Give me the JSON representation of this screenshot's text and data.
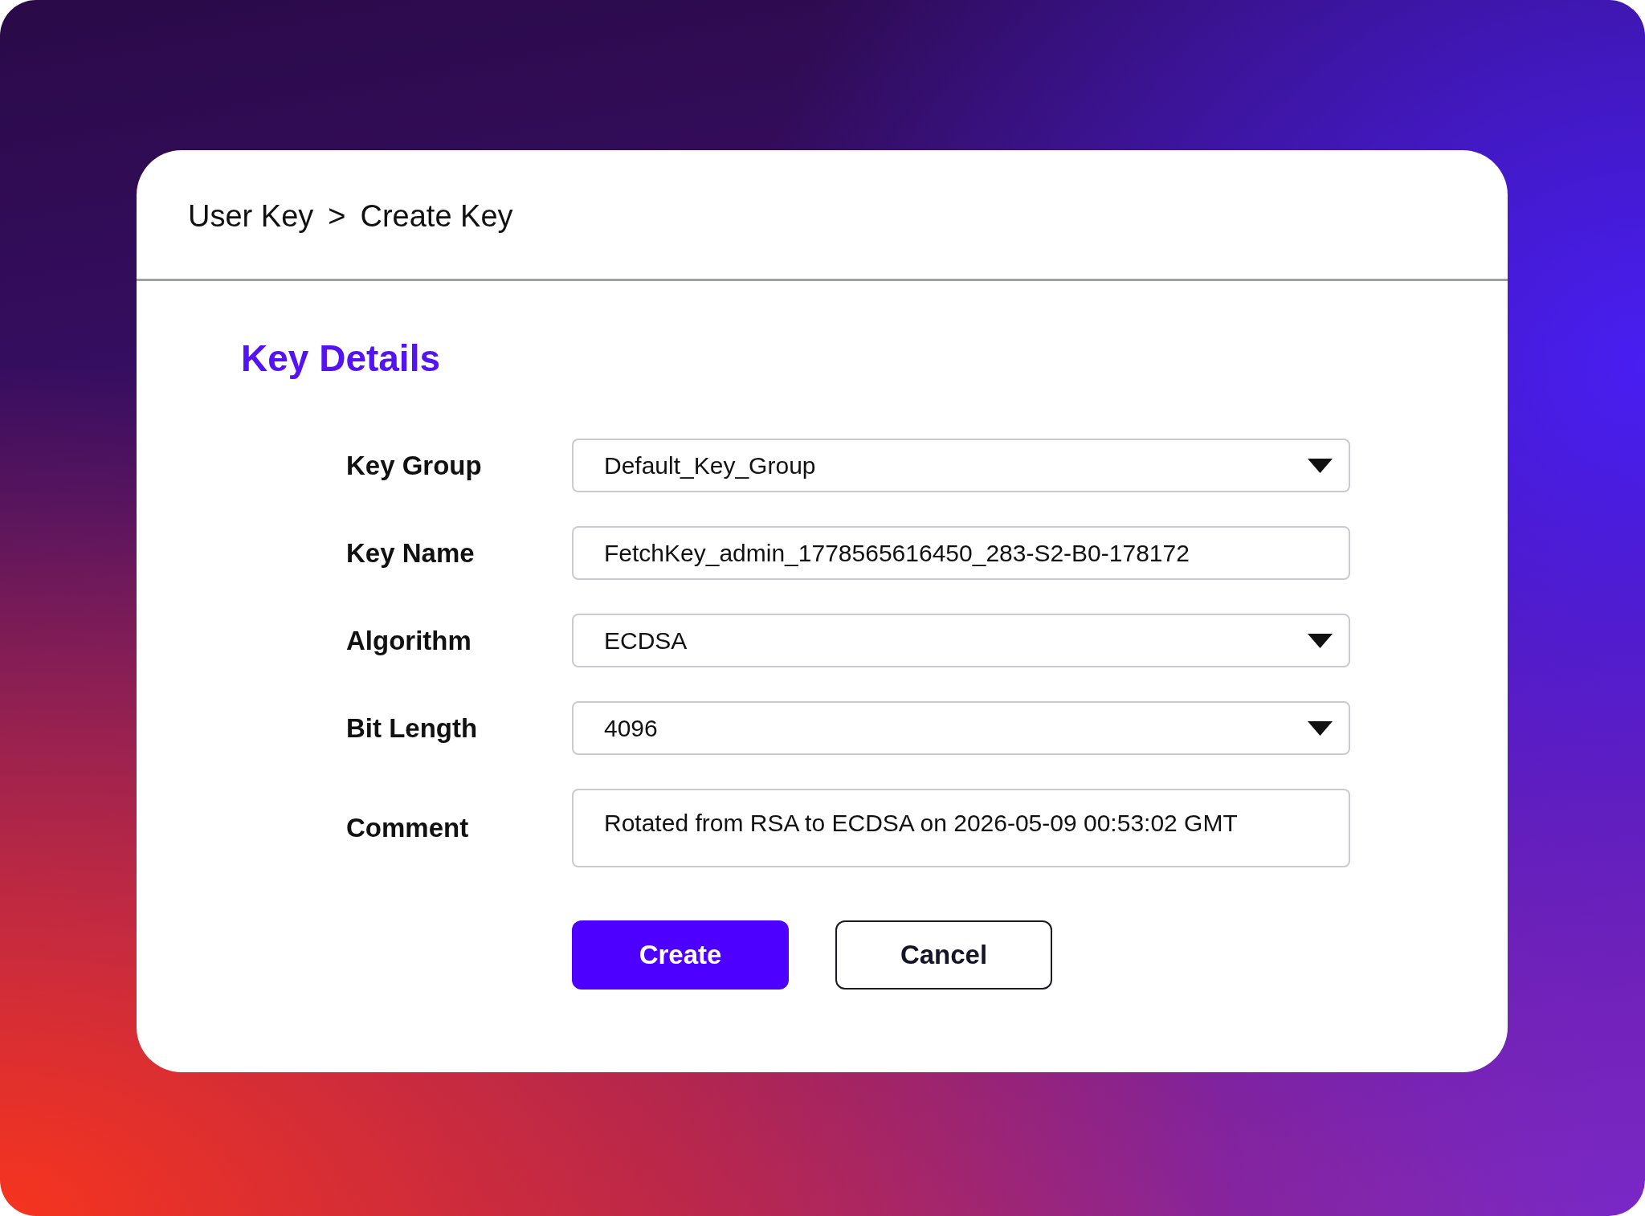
{
  "breadcrumb": {
    "items": [
      {
        "label": "User Key"
      },
      {
        "label": "Create Key"
      }
    ],
    "separator": ">"
  },
  "section_title": "Key Details",
  "fields": [
    {
      "label": "Key Group",
      "kind": "dropdown",
      "value": "Default_Key_Group"
    },
    {
      "label": "Key Name",
      "kind": "text",
      "value": "FetchKey_admin_1778565616450_283-S2-B0-178172"
    },
    {
      "label": "Algorithm",
      "kind": "dropdown",
      "value": "ECDSA"
    },
    {
      "label": "Bit Length",
      "kind": "dropdown",
      "value": "4096"
    },
    {
      "label": "Comment",
      "kind": "textarea",
      "value": "Rotated from RSA to ECDSA on 2026-05-09 00:53:02 GMT"
    }
  ],
  "buttons": [
    {
      "label": "Create",
      "kind": "primary"
    },
    {
      "label": "Cancel",
      "kind": "secondary"
    }
  ]
}
